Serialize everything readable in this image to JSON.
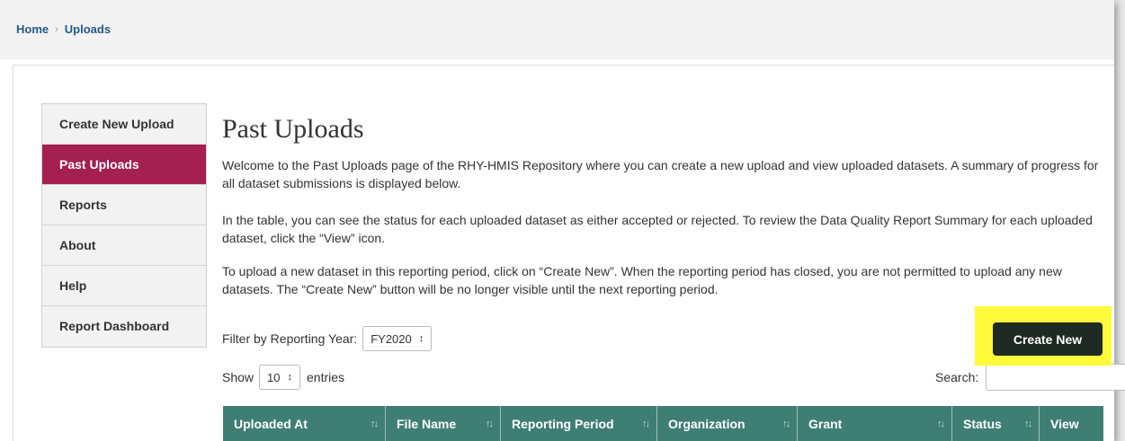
{
  "breadcrumb": {
    "home": "Home",
    "separator": "›",
    "current": "Uploads"
  },
  "sidebar": {
    "items": [
      {
        "label": "Create New Upload",
        "active": false
      },
      {
        "label": "Past Uploads",
        "active": true
      },
      {
        "label": "Reports",
        "active": false
      },
      {
        "label": "About",
        "active": false
      },
      {
        "label": "Help",
        "active": false
      },
      {
        "label": "Report Dashboard",
        "active": false
      }
    ]
  },
  "main": {
    "title": "Past Uploads",
    "paragraph1": "Welcome to the Past Uploads page of the RHY-HMIS Repository where you can create a new upload and view uploaded datasets. A summary of progress for all dataset submissions is displayed below.",
    "paragraph2": "In the table, you can see the status for each uploaded dataset as either accepted or rejected. To review the Data Quality Report Summary for each uploaded dataset, click the “View” icon.",
    "paragraph3": "To upload a new dataset in this reporting period, click on “Create New”. When the reporting period has closed, you are not permitted to upload any new datasets. The “Create New” button will be no longer visible until the next reporting period.",
    "filter_label": "Filter by Reporting Year:",
    "filter_value": "FY2020",
    "create_button": "Create New",
    "show_label": "Show",
    "show_value": "10",
    "entries_label": "entries",
    "search_label": "Search:",
    "search_value": ""
  },
  "table": {
    "columns": [
      {
        "label": "Uploaded At",
        "sort_icon": "↑↓"
      },
      {
        "label": "File Name",
        "sort_icon": "↑↓"
      },
      {
        "label": "Reporting Period",
        "sort_icon": "↑↓"
      },
      {
        "label": "Organization",
        "sort_icon": "↑↓"
      },
      {
        "label": "Grant",
        "sort_icon": "↑↓"
      },
      {
        "label": "Status",
        "sort_icon": "↑↓"
      },
      {
        "label": "View",
        "sort_icon": ""
      }
    ]
  },
  "colors": {
    "accent_active": "#a3204f",
    "table_header": "#3f7f73",
    "button_dark": "#1f2a24",
    "highlight": "#fffb3a",
    "link": "#1f5a8a"
  }
}
